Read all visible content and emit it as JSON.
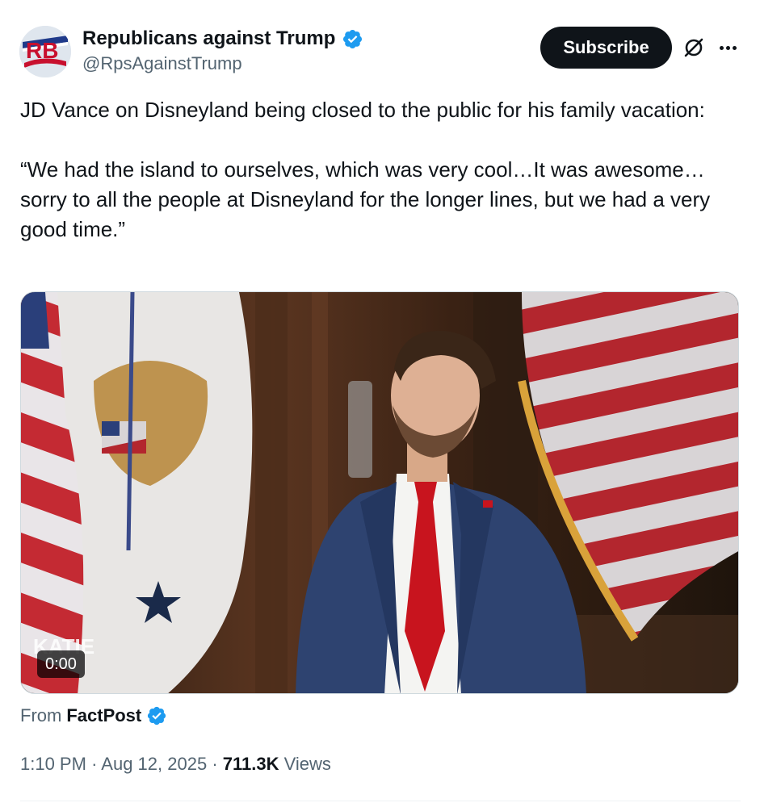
{
  "author": {
    "display_name": "Republicans against Trump",
    "handle": "@RpsAgainstTrump",
    "avatar_letters": "RB"
  },
  "actions": {
    "subscribe_label": "Subscribe",
    "grok_icon": "grok-slash-circle-icon",
    "more_icon": "more-dots-icon"
  },
  "tweet": {
    "paragraph_1": "JD Vance on Disneyland being closed to the public for his family vacation:",
    "paragraph_2": "“We had the island to ourselves, which was very cool…It was awesome… sorry to all the people at Disneyland for the longer lines, but we had a very good time.”"
  },
  "media": {
    "video_time": "0:00",
    "watermark_text": "KATIE"
  },
  "source": {
    "prefix": "From",
    "name": "FactPost"
  },
  "meta": {
    "time": "1:10 PM",
    "separator": "·",
    "date": "Aug 12, 2025",
    "views_count": "711.3K",
    "views_label": "Views"
  },
  "colors": {
    "text_primary": "#0f1419",
    "text_secondary": "#536471",
    "verified_blue": "#1d9bf0",
    "button_dark": "#0f1419"
  }
}
